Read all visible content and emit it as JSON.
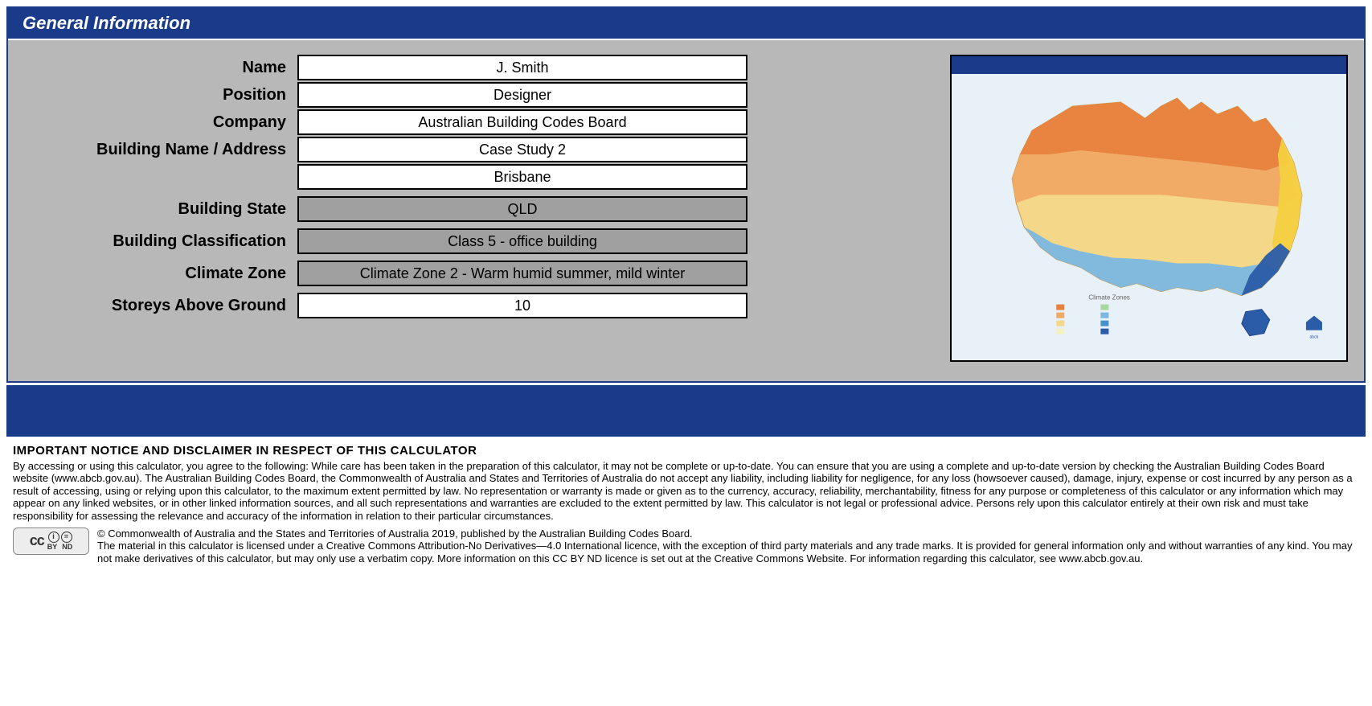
{
  "header": "General Information",
  "form": {
    "name": {
      "label": "Name",
      "value": "J. Smith"
    },
    "position": {
      "label": "Position",
      "value": "Designer"
    },
    "company": {
      "label": "Company",
      "value": "Australian Building Codes Board"
    },
    "building_name_address": {
      "label": "Building Name / Address",
      "line1": "Case Study 2",
      "line2": "Brisbane"
    },
    "building_state": {
      "label": "Building State",
      "value": "QLD"
    },
    "building_classification": {
      "label": "Building Classification",
      "value": "Class 5 - office building"
    },
    "climate_zone": {
      "label": "Climate Zone",
      "value": "Climate Zone 2 - Warm humid summer, mild winter"
    },
    "storeys": {
      "label": "Storeys Above Ground",
      "value": "10"
    }
  },
  "map": {
    "legend_title": "Climate Zones"
  },
  "disclaimer": {
    "title": "IMPORTANT NOTICE AND DISCLAIMER IN RESPECT OF THIS CALCULATOR",
    "body": "By accessing or using this calculator, you agree to the following: While care has been taken in the preparation of this calculator, it may not be complete or up-to-date.  You can ensure that you are using a complete and up-to-date version by checking the Australian Building Codes Board website (www.abcb.gov.au). The Australian Building Codes Board, the Commonwealth of Australia and States and Territories of Australia do not accept any liability, including liability for negligence, for any loss (howsoever caused), damage, injury, expense or cost incurred by any person as a result of accessing, using or relying upon this calculator, to the maximum extent permitted by law. No representation or warranty is made or given as to the currency, accuracy, reliability, merchantability, fitness for any purpose or completeness of this calculator or any information which may appear on any linked websites, or in other linked information sources, and all such representations and warranties are excluded to the extent permitted by law. This calculator is not legal or professional advice.  Persons rely upon this calculator entirely at their own risk and must take responsibility for assessing the relevance and accuracy of the information in relation to their particular circumstances."
  },
  "copyright": {
    "text": "© Commonwealth of Australia and the States and Territories of Australia 2019, published by the Australian Building Codes Board.\nThe material in this calculator is licensed under a Creative Commons Attribution-No Derivatives—4.0 International licence, with the exception of third party materials and any trade marks.  It is provided for general information only and without warranties of any kind. You may not make derivatives of this calculator, but may only use a verbatim copy. More information on this CC BY ND licence is set out at the Creative Commons Website. For information regarding this calculator, see www.abcb.gov.au.",
    "cc_label_by": "BY",
    "cc_label_nd": "ND",
    "cc_main": "cc"
  }
}
